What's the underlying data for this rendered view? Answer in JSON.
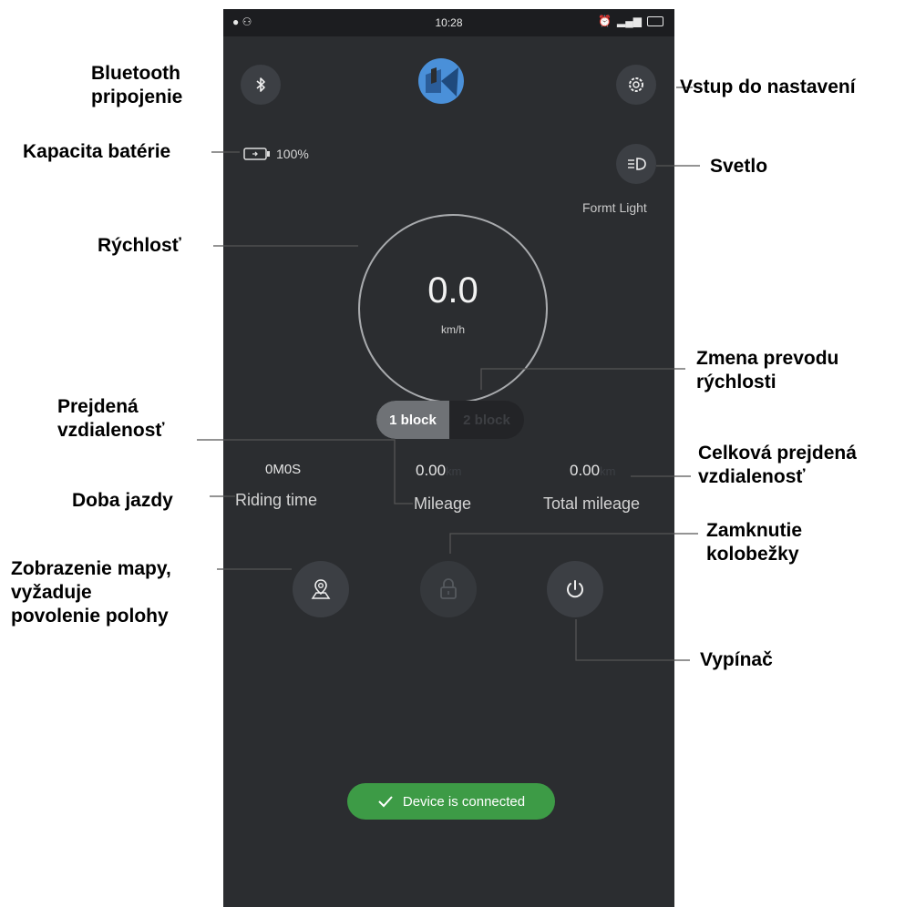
{
  "status_bar": {
    "time": "10:28"
  },
  "app": {
    "battery_percent": "100%",
    "light_label": "Formt Light",
    "speed_value": "0.0",
    "speed_unit": "km/h",
    "gear_active": "1 block",
    "gear_inactive": "2 block",
    "riding_time_value": "0M0S",
    "riding_time_label": "Riding time",
    "mileage_value": "0.00",
    "mileage_unit": "km",
    "mileage_label": "Mileage",
    "total_mileage_value": "0.00",
    "total_mileage_unit": "km",
    "total_mileage_label": "Total mileage",
    "toast_text": "Device is connected"
  },
  "annotations": {
    "bluetooth": [
      "Bluetooth",
      "pripojenie"
    ],
    "settings": "Vstup do nastavení",
    "battery": "Kapacita batérie",
    "light": "Svetlo",
    "speed": "Rýchlosť",
    "gear": [
      "Zmena prevodu",
      "rýchlosti"
    ],
    "distance": [
      "Prejdená",
      "vzdialenosť"
    ],
    "total_distance": [
      "Celková prejdená",
      "vzdialenosť"
    ],
    "riding_time": "Doba jazdy",
    "lock": [
      "Zamknutie",
      "kolobežky"
    ],
    "map": [
      "Zobrazenie mapy,",
      "vyžaduje",
      "povolenie polohy"
    ],
    "power": "Vypínač"
  },
  "colors": {
    "background": "#2b2d30",
    "button": "#3c3f44",
    "toast": "#3d9b46",
    "logo_blue": "#4a90d9"
  }
}
